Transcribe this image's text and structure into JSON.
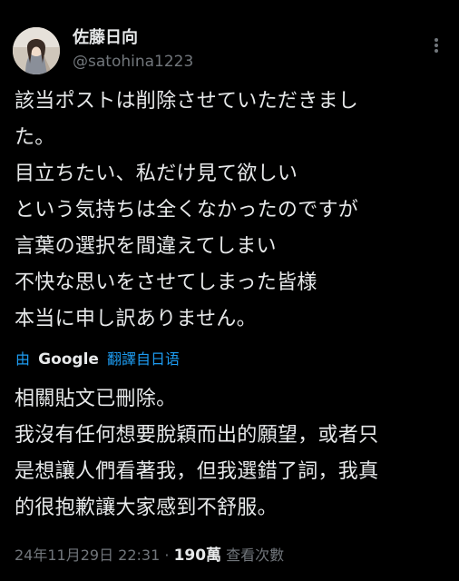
{
  "author": {
    "display_name": "佐藤日向",
    "handle": "@satohina1223"
  },
  "icons": {
    "more": "more-options-icon",
    "avatar": "avatar"
  },
  "tweet": {
    "lines": [
      "該当ポストは削除させていただきまし",
      "た。",
      "目立ちたい、私だけ見て欲しい",
      "という気持ちは全くなかったのですが",
      "言葉の選択を間違えてしまい",
      "不快な思いをさせてしまった皆様",
      "本当に申し訳ありません。"
    ]
  },
  "translation": {
    "by": "由",
    "provider": "Google",
    "from": "翻譯自日语",
    "lines": [
      "相關貼文已刪除。",
      "我沒有任何想要脫穎而出的願望，或者只",
      "是想讓人們看著我，但我選錯了詞，我真",
      "的很抱歉讓大家感到不舒服。"
    ]
  },
  "meta": {
    "timestamp": "24年11月29日 22:31",
    "separator": "·",
    "views_count": "190萬",
    "views_label": "查看次數"
  },
  "colors": {
    "background": "#000000",
    "text_primary": "#e7e9ea",
    "text_secondary": "#71767b",
    "link": "#1d9bf0"
  }
}
